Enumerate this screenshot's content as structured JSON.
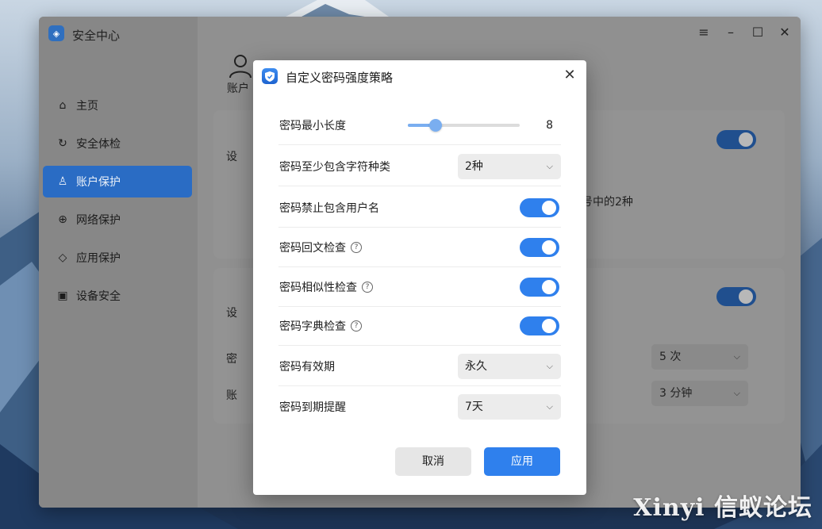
{
  "window": {
    "title": "安全中心"
  },
  "sidebar": {
    "items": [
      {
        "label": "主页",
        "icon": "home-icon"
      },
      {
        "label": "安全体检",
        "icon": "refresh-icon"
      },
      {
        "label": "账户保护",
        "icon": "user-icon",
        "active": true
      },
      {
        "label": "网络保护",
        "icon": "globe-icon"
      },
      {
        "label": "应用保护",
        "icon": "shield-icon"
      },
      {
        "label": "设备安全",
        "icon": "device-icon"
      }
    ]
  },
  "background": {
    "page_title": "账户",
    "row_text_1": "号中的2种",
    "select_attempts": "5 次",
    "select_lock": "3 分钟",
    "label_1": "设",
    "label_2": "设",
    "label_3": "密",
    "label_4": "账"
  },
  "dialog": {
    "title": "自定义密码强度策略",
    "rows": {
      "min_length": {
        "label": "密码最小长度",
        "value": "8",
        "fraction": 0.25
      },
      "char_types": {
        "label": "密码至少包含字符种类",
        "value": "2种"
      },
      "no_username": {
        "label": "密码禁止包含用户名",
        "on": true
      },
      "palindrome": {
        "label": "密码回文检查",
        "on": true
      },
      "similarity": {
        "label": "密码相似性检查",
        "on": true
      },
      "dictionary": {
        "label": "密码字典检查",
        "on": true
      },
      "validity": {
        "label": "密码有效期",
        "value": "永久"
      },
      "expiry_reminder": {
        "label": "密码到期提醒",
        "value": "7天"
      }
    },
    "cancel_label": "取消",
    "apply_label": "应用"
  },
  "watermark": "Xinyi 信蚁论坛",
  "colors": {
    "accent": "#2f80ed",
    "sidebar_active": "#2a6cc4"
  }
}
